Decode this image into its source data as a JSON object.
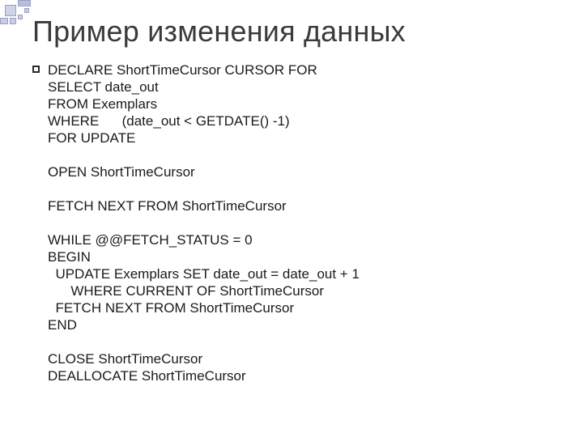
{
  "title": "Пример изменения данных",
  "lines": [
    {
      "bullet": true,
      "text": "DECLARE ShortTimeCursor CURSOR FOR"
    },
    {
      "bullet": false,
      "text": "SELECT date_out"
    },
    {
      "bullet": false,
      "text": "FROM Exemplars"
    },
    {
      "bullet": false,
      "text": "WHERE      (date_out < GETDATE() -1)"
    },
    {
      "bullet": false,
      "text": "FOR UPDATE"
    },
    {
      "bullet": false,
      "text": ""
    },
    {
      "bullet": false,
      "text": "OPEN ShortTimeCursor"
    },
    {
      "bullet": false,
      "text": ""
    },
    {
      "bullet": false,
      "text": "FETCH NEXT FROM ShortTimeCursor"
    },
    {
      "bullet": false,
      "text": ""
    },
    {
      "bullet": false,
      "text": "WHILE @@FETCH_STATUS = 0"
    },
    {
      "bullet": false,
      "text": "BEGIN"
    },
    {
      "bullet": false,
      "text": "  UPDATE Exemplars SET date_out = date_out + 1"
    },
    {
      "bullet": false,
      "text": "      WHERE CURRENT OF ShortTimeCursor"
    },
    {
      "bullet": false,
      "text": "  FETCH NEXT FROM ShortTimeCursor"
    },
    {
      "bullet": false,
      "text": "END"
    },
    {
      "bullet": false,
      "text": ""
    },
    {
      "bullet": false,
      "text": "CLOSE ShortTimeCursor"
    },
    {
      "bullet": false,
      "text": "DEALLOCATE ShortTimeCursor"
    }
  ]
}
